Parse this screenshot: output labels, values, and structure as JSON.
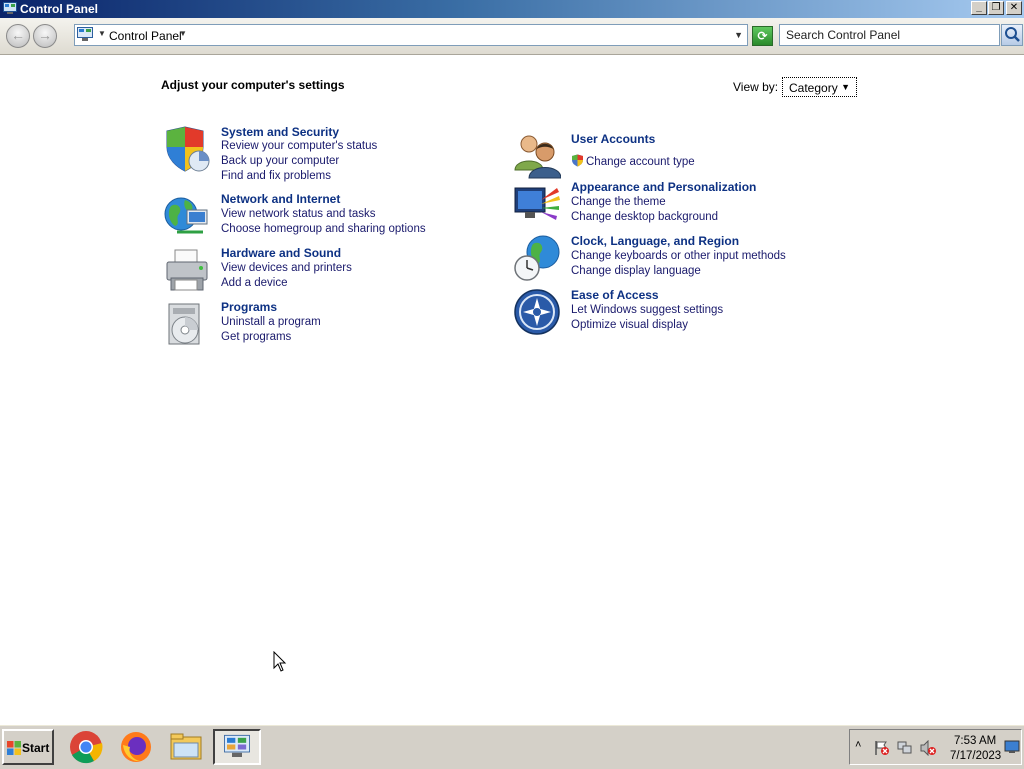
{
  "window": {
    "title": "Control Panel"
  },
  "address_bar": {
    "breadcrumb": "Control Panel",
    "search_placeholder": "Search Control Panel"
  },
  "content": {
    "heading": "Adjust your computer's settings",
    "view_by_label": "View by:",
    "view_by_value": "Category",
    "left_column": [
      {
        "icon": "shield-icon",
        "title": "System and Security",
        "links": [
          "Review your computer's status",
          "Back up your computer",
          "Find and fix problems"
        ]
      },
      {
        "icon": "globe-network-icon",
        "title": "Network and Internet",
        "links": [
          "View network status and tasks",
          "Choose homegroup and sharing options"
        ]
      },
      {
        "icon": "printer-icon",
        "title": "Hardware and Sound",
        "links": [
          "View devices and printers",
          "Add a device"
        ]
      },
      {
        "icon": "programs-disc-icon",
        "title": "Programs",
        "links": [
          "Uninstall a program",
          "Get programs"
        ]
      }
    ],
    "right_column": [
      {
        "icon": "users-icon",
        "title": "User Accounts",
        "links": [
          "Change account type"
        ]
      },
      {
        "icon": "monitor-paint-icon",
        "title": "Appearance and Personalization",
        "links": [
          "Change the theme",
          "Change desktop background"
        ]
      },
      {
        "icon": "clock-globe-icon",
        "title": "Clock, Language, and Region",
        "links": [
          "Change keyboards or other input methods",
          "Change display language"
        ]
      },
      {
        "icon": "ease-of-access-icon",
        "title": "Ease of Access",
        "links": [
          "Let Windows suggest settings",
          "Optimize visual display"
        ]
      }
    ]
  },
  "taskbar": {
    "start_label": "Start",
    "apps": [
      "chrome-icon",
      "firefox-icon",
      "file-explorer-icon",
      "control-panel-icon"
    ],
    "clock_time": "7:53 AM",
    "clock_date": "7/17/2023"
  }
}
